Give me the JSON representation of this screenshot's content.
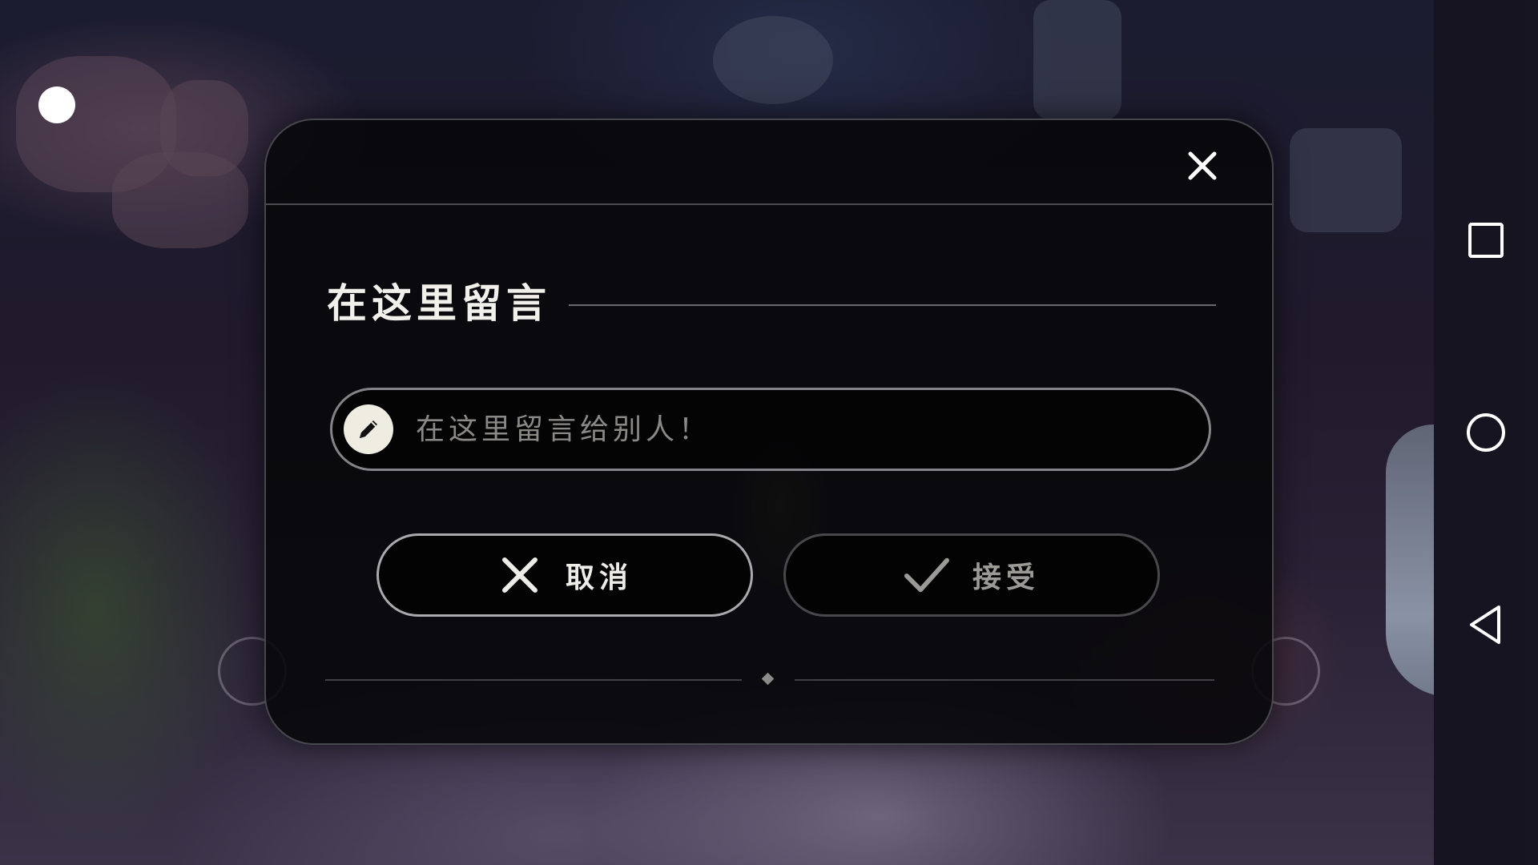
{
  "dialog": {
    "title": "在这里留言",
    "input": {
      "placeholder": "在这里留言给别人！",
      "value": ""
    },
    "buttons": {
      "cancel_label": "取消",
      "accept_label": "接受"
    },
    "icons": {
      "close": "close-icon",
      "pencil": "pencil-icon",
      "cancel": "x-icon",
      "accept": "checkmark-icon"
    }
  },
  "navbar": {
    "items": [
      "recents-icon",
      "home-icon",
      "back-icon"
    ]
  },
  "colors": {
    "dialog_bg": "#08080a",
    "text_primary": "#f2f0ea",
    "text_muted": "#8b8986",
    "pencil_badge": "#efece2"
  }
}
